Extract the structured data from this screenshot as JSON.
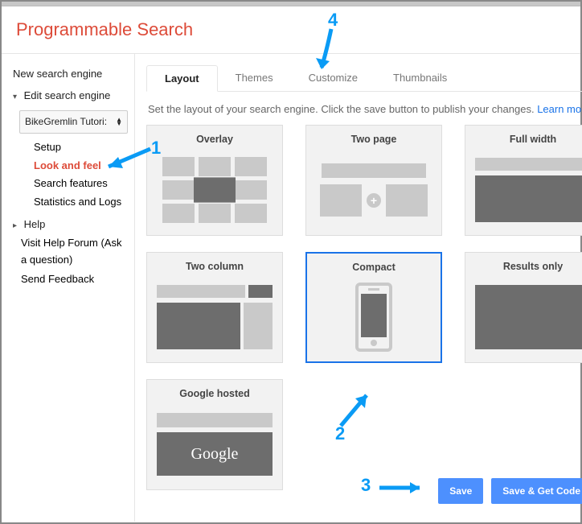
{
  "header": {
    "title": "Programmable Search"
  },
  "sidebar": {
    "new_label": "New search engine",
    "edit_label": "Edit search engine",
    "engine_selected": "BikeGremlin Tutori:",
    "items": [
      {
        "label": "Setup"
      },
      {
        "label": "Look and feel"
      },
      {
        "label": "Search features"
      },
      {
        "label": "Statistics and Logs"
      }
    ],
    "help_label": "Help",
    "visit_forum": "Visit Help Forum (Ask a question)",
    "send_feedback": "Send Feedback"
  },
  "tabs": [
    {
      "label": "Layout",
      "selected": true
    },
    {
      "label": "Themes"
    },
    {
      "label": "Customize"
    },
    {
      "label": "Thumbnails"
    }
  ],
  "description": {
    "text": "Set the layout of your search engine. Click the save button to publish your changes. ",
    "link": "Learn mo"
  },
  "layouts": [
    {
      "key": "overlay",
      "title": "Overlay"
    },
    {
      "key": "two_page",
      "title": "Two page"
    },
    {
      "key": "full_width",
      "title": "Full width"
    },
    {
      "key": "two_column",
      "title": "Two column"
    },
    {
      "key": "compact",
      "title": "Compact",
      "selected": true
    },
    {
      "key": "results_only",
      "title": "Results only"
    },
    {
      "key": "google_hosted",
      "title": "Google hosted"
    }
  ],
  "google_logo_text": "Google",
  "buttons": {
    "save": "Save",
    "save_get_code": "Save & Get Code"
  },
  "annotations": {
    "n1": "1",
    "n2": "2",
    "n3": "3",
    "n4": "4"
  }
}
